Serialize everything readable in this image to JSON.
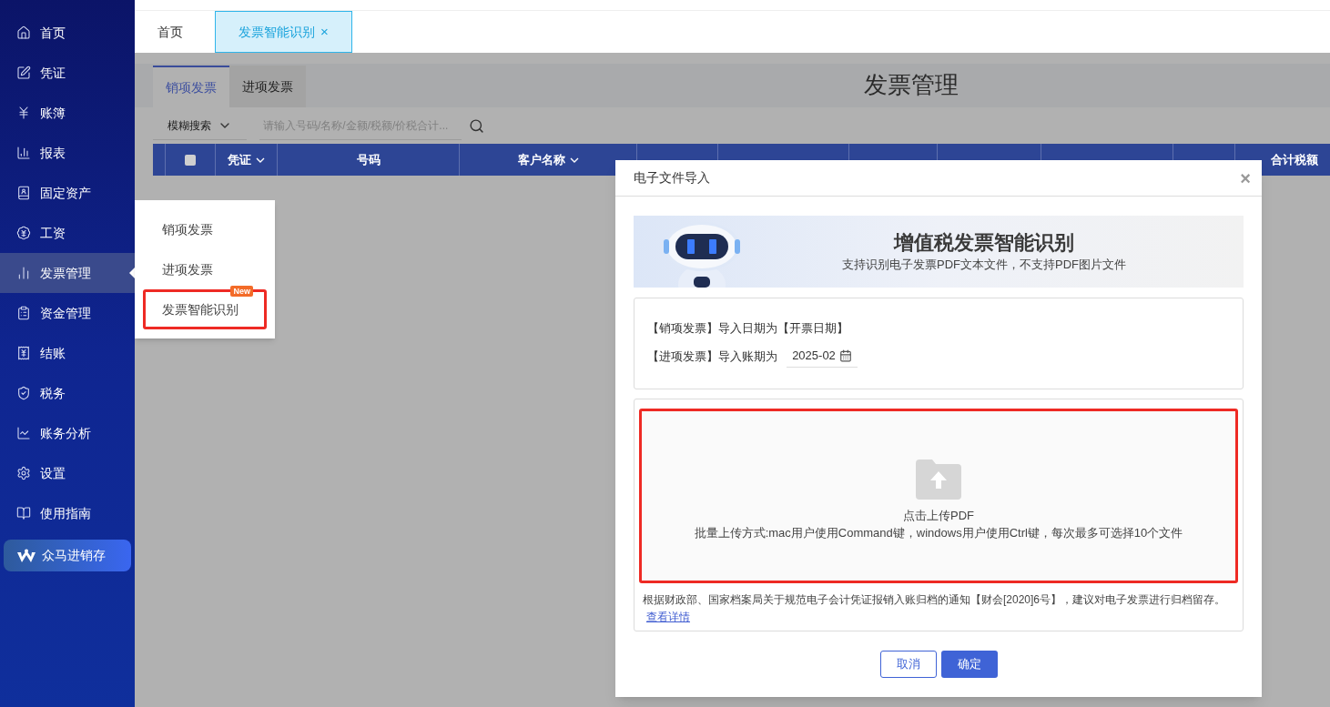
{
  "sidebar": {
    "items": [
      {
        "label": "首页",
        "selected": false
      },
      {
        "label": "凭证",
        "selected": false
      },
      {
        "label": "账簿",
        "selected": false
      },
      {
        "label": "报表",
        "selected": false
      },
      {
        "label": "固定资产",
        "selected": false
      },
      {
        "label": "工资",
        "selected": false
      },
      {
        "label": "发票管理",
        "selected": true
      },
      {
        "label": "资金管理",
        "selected": false
      },
      {
        "label": "结账",
        "selected": false
      },
      {
        "label": "税务",
        "selected": false
      },
      {
        "label": "账务分析",
        "selected": false
      },
      {
        "label": "设置",
        "selected": false
      },
      {
        "label": "使用指南",
        "selected": false
      }
    ],
    "promo": {
      "label": "众马进销存"
    }
  },
  "submenu": {
    "items": [
      {
        "label": "销项发票",
        "outlined": false
      },
      {
        "label": "进项发票",
        "outlined": false
      },
      {
        "label": "发票智能识别",
        "badge": "New",
        "outlined": true
      }
    ]
  },
  "page_tabs": [
    {
      "label": "首页",
      "selected": false
    },
    {
      "label": "发票智能识别",
      "selected": true,
      "close": "×"
    }
  ],
  "title": "发票管理",
  "invoice_tabs": [
    {
      "label": "销项发票",
      "selected": true
    },
    {
      "label": "进项发票",
      "selected": false
    }
  ],
  "search": {
    "mode": "模糊搜索",
    "placeholder": "请输入号码/名称/金额/税额/价税合计..."
  },
  "table": {
    "select_all": {
      "checked": false
    },
    "columns": [
      {
        "label": "凭证",
        "sortable": true
      },
      {
        "label": "号码",
        "sortable": false
      },
      {
        "label": "客户名称",
        "sortable": true
      },
      {
        "label": "合计税额",
        "sortable": false
      }
    ]
  },
  "dialog": {
    "title": "电子文件导入",
    "close": "×",
    "banner": {
      "title": "增值税发票智能识别",
      "subtitle": "支持识别电子发票PDF文本文件，不支持PDF图片文件"
    },
    "info": {
      "line1": "【销项发票】导入日期为【开票日期】",
      "line2_label": "【进项发票】导入账期为",
      "period": "2025-02"
    },
    "upload": {
      "label": "点击上传PDF",
      "hint": "批量上传方式:mac用户使用Command键，windows用户使用Ctrl键，每次最多可选择10个文件",
      "outlined": true
    },
    "note": {
      "text": "根据财政部、国家档案局关于规范电子会计凭证报销入账归档的通知【财会[2020]6号】，建议对电子发票进行归档留存。",
      "link": "查看详情"
    },
    "buttons": [
      {
        "label": "取消",
        "kind": "secondary"
      },
      {
        "label": "确定",
        "kind": "primary"
      }
    ]
  }
}
